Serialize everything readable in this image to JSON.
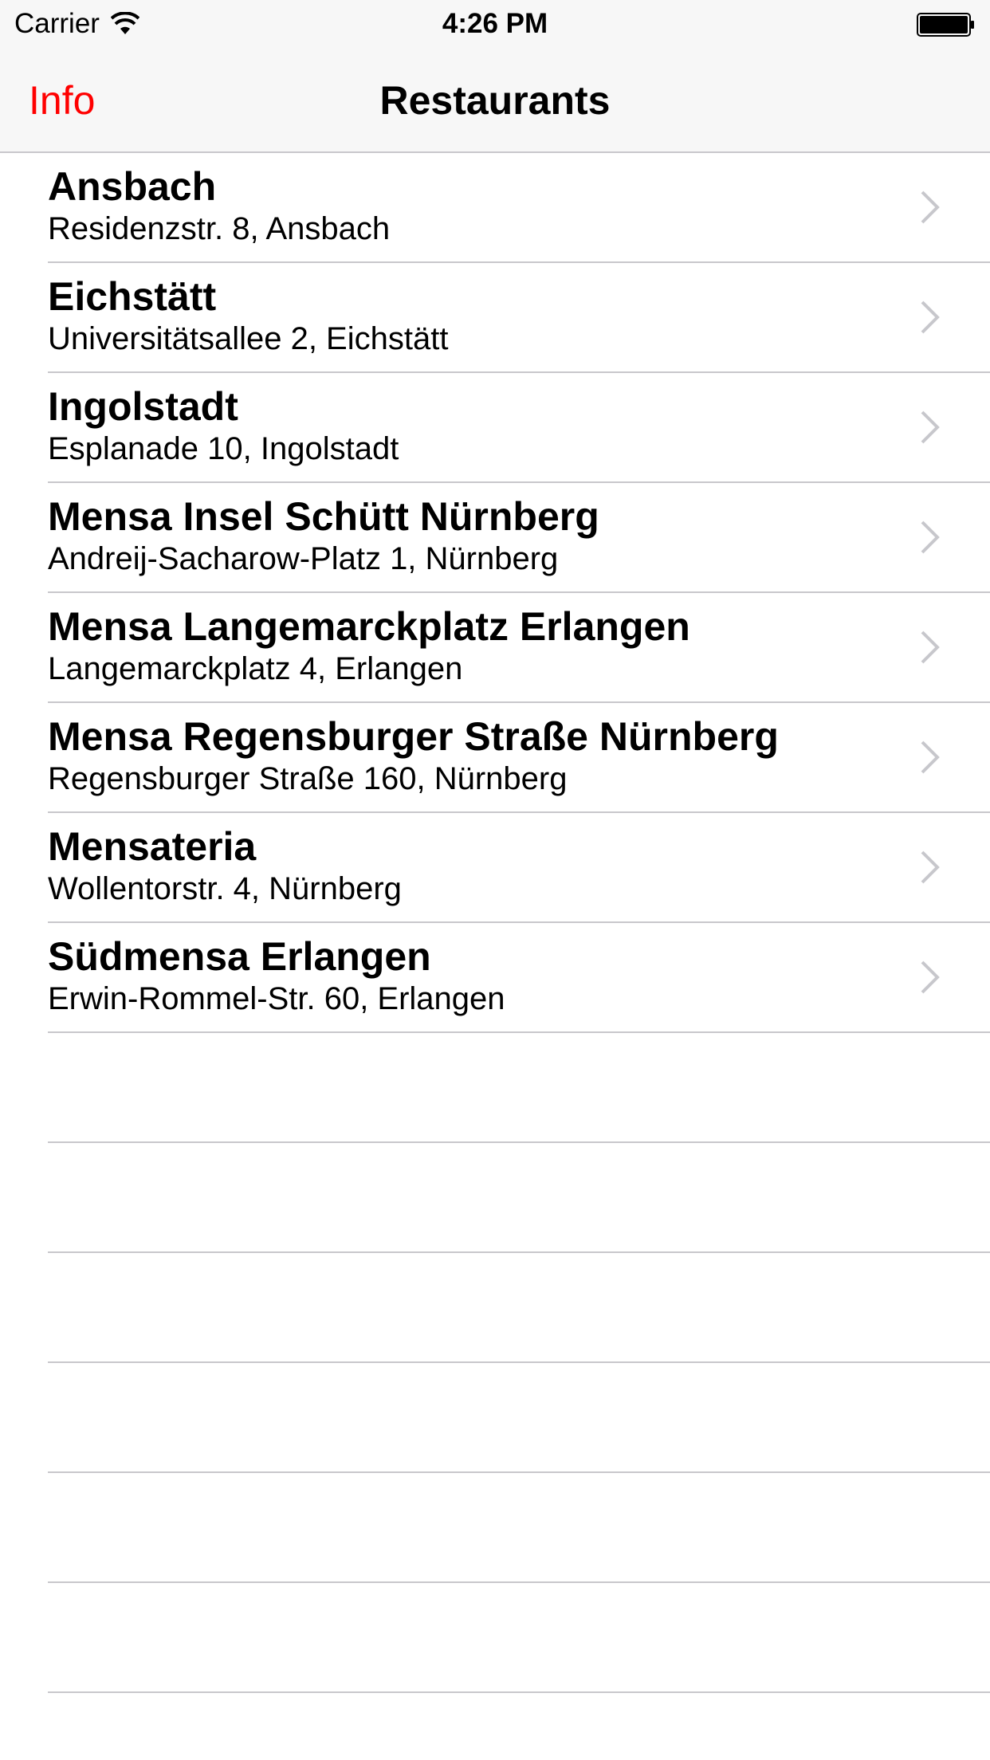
{
  "status_bar": {
    "carrier": "Carrier",
    "time": "4:26 PM",
    "wifi_icon": "wifi-icon",
    "battery_icon": "battery-full-icon"
  },
  "nav": {
    "left_button": "Info",
    "title": "Restaurants",
    "accent_color": "#ff0000"
  },
  "restaurants": [
    {
      "name": "Ansbach",
      "address": "Residenzstr. 8, Ansbach"
    },
    {
      "name": "Eichstätt",
      "address": "Universitätsallee 2, Eichstätt"
    },
    {
      "name": "Ingolstadt",
      "address": "Esplanade 10, Ingolstadt"
    },
    {
      "name": "Mensa Insel Schütt Nürnberg",
      "address": "Andreij-Sacharow-Platz 1, Nürnberg"
    },
    {
      "name": "Mensa Langemarckplatz Erlangen",
      "address": "Langemarckplatz 4, Erlangen"
    },
    {
      "name": "Mensa Regensburger Straße Nürnberg",
      "address": "Regensburger Straße 160, Nürnberg"
    },
    {
      "name": "Mensateria",
      "address": "Wollentorstr. 4, Nürnberg"
    },
    {
      "name": "Südmensa Erlangen",
      "address": "Erwin-Rommel-Str. 60, Erlangen"
    }
  ],
  "row_accessory_icon": "chevron-right-icon"
}
